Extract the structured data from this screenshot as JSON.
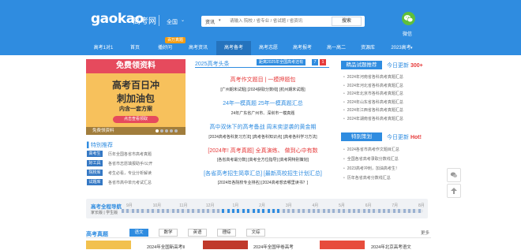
{
  "header": {
    "logo": "gaokao",
    "logo_cn": "高考网",
    "region": "全国",
    "search_type": "资讯",
    "search_placeholder": "请输入 院校 / 省专业 / 省试题 / 省资讯",
    "search_button": "搜索",
    "wechat_label": "微信"
  },
  "nav": {
    "items": [
      "高考1对1",
      "首页",
      "播好问",
      "高考资讯",
      "高考备考",
      "高考志愿",
      "高考报考",
      "高一高二",
      "资源库",
      "2023高考"
    ],
    "active": "高考备考",
    "badge": "百万真题"
  },
  "banner": {
    "top": "免费领资料",
    "line1": "高考百日冲",
    "line2": "刺加油包",
    "line3": "内含一套方案",
    "button": "点击查看领取",
    "caption": "免费领资料"
  },
  "recommend": {
    "title": "特别推荐",
    "rows": [
      {
        "tag": "高考生",
        "text": "历年全国各省市高考真题"
      },
      {
        "tag": "好工具",
        "text": "各省市志愿填报助手/公开"
      },
      {
        "tag": "院校库",
        "text": "考生必看，专业分析解读"
      },
      {
        "tag": "试题库",
        "text": "各省市高中单元考试汇总"
      }
    ]
  },
  "news": {
    "title": "2025高考头条",
    "tag": "距离2025年全国高考还有",
    "days": [
      "7",
      "1"
    ],
    "headlines": [
      {
        "text": "高考作文题目 | 一模押题包",
        "color": "#e63b3b",
        "subs": "[广州期末试题] [2024获取分数线] [杭州期末试题]"
      },
      {
        "text": "24年一模真题 25年一模真题汇总",
        "color": "#2f8ce0",
        "subs": "24年广东省广州市、深圳市一模真题"
      },
      {
        "text": "高中双休下的高考备战 周末奕逆袭的黄金期",
        "color": "#2f8ce0",
        "subs": "[2024高考各科复习方法] [高考各科知识点] [高考各科学习方法]"
      },
      {
        "text": "[2024年! 高考真题] 全真演练、 做到心中有数",
        "color": "#e63b3b",
        "subs": "[各省高考最分数] [高考全方位指导] [高考网特别策划]"
      },
      {
        "text": "[各省高考招生简章汇总] [最新高校招生计划汇总]",
        "color": "#2f8ce0",
        "subs": "[2024年各院校专业排名] [2024高考想去哪里读书？]"
      }
    ]
  },
  "side_top": {
    "tab": "精品试题推荐",
    "update_label": "今日更新",
    "update_count": "300+",
    "items": [
      "2024年河南省各科高考真题汇总",
      "2024年河北省各科高考真题汇总",
      "2024年北京市各科高考真题汇总",
      "2024年山东省各科高考真题汇总",
      "2024年江西省各科高考真题汇总",
      "2024年湖南省各科高考真题汇总"
    ]
  },
  "side_bottom": {
    "tab": "特别策划",
    "update_label": "今日更新",
    "update_count": "Hot!",
    "items": [
      "2024各省市高考作文题目汇总",
      "全国各省高考录取分数线汇总",
      "2023高考冲刺，加油高考生！",
      "历年各省高考分数线汇总"
    ]
  },
  "timeline": {
    "title": "高考全程导航",
    "sub": "家长版 | 学生版",
    "months": [
      "9月",
      "10月",
      "11月",
      "12月",
      "1月",
      "2月",
      "3月",
      "4月",
      "5月",
      "6月",
      "7月",
      "8月"
    ],
    "progress": 0.5
  },
  "zhenti": {
    "title": "高考真题",
    "tabs": [
      "语文",
      "数学",
      "英语",
      "理综",
      "文综"
    ],
    "active": "语文",
    "more": "更多",
    "items": [
      "2024年全国新高考Ⅱ",
      "2024年全国甲卷高考",
      "2024年北京高考语文"
    ]
  },
  "colors": {
    "primary": "#2f8ce0",
    "red": "#e63b3b",
    "wechat": "#5fbf3b"
  },
  "icons": {
    "float_1": "chat-icon",
    "float_2": "back-to-top-icon"
  }
}
